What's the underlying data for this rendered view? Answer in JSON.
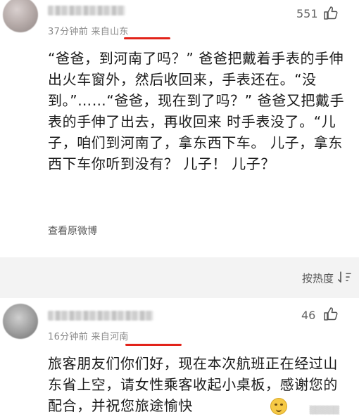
{
  "comments": [
    {
      "meta": "37分钟前 来自山东",
      "likes": "551",
      "text": "“爸爸，到河南了吗？” 爸爸把戴着手表的手伸出火车窗外，然后收回来，手表还在。“没到。”……“爸爸，现在到了吗？” 爸爸又把戴手表的手伸了出去，再收回来 时手表没了。“儿子，咱们到河南了，拿东西下车。 儿子，拿东西下车你听到没有？ 儿子！ 儿子？",
      "view_original": "查看原微博"
    },
    {
      "meta": "16分钟前 来自河南",
      "likes": "46",
      "text": "旅客朋友们你们好，现在本次航班正在经过山东省上空，请女性乘客收起小桌板，感谢您的配合，并祝您旅途愉快"
    }
  ],
  "sort_label": "按热度",
  "colors": {
    "highlight_underline": "#e2231a",
    "band": "#f3f3f3"
  },
  "icons": {
    "like": "thumbs-up-icon",
    "sort": "sort-icon",
    "emoji": "grin-emoji-icon"
  }
}
